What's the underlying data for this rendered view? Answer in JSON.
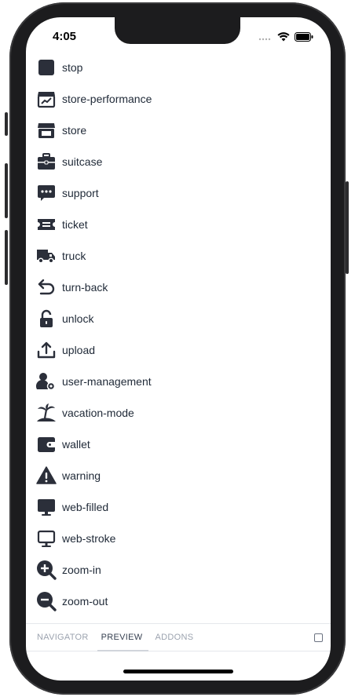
{
  "status_bar": {
    "time": "4:05"
  },
  "icon_list": [
    {
      "label": "stop",
      "icon": "stop-icon"
    },
    {
      "label": "store-performance",
      "icon": "store-performance-icon"
    },
    {
      "label": "store",
      "icon": "store-icon"
    },
    {
      "label": "suitcase",
      "icon": "suitcase-icon"
    },
    {
      "label": "support",
      "icon": "support-icon"
    },
    {
      "label": "ticket",
      "icon": "ticket-icon"
    },
    {
      "label": "truck",
      "icon": "truck-icon"
    },
    {
      "label": "turn-back",
      "icon": "turn-back-icon"
    },
    {
      "label": "unlock",
      "icon": "unlock-icon"
    },
    {
      "label": "upload",
      "icon": "upload-icon"
    },
    {
      "label": "user-management",
      "icon": "user-management-icon"
    },
    {
      "label": "vacation-mode",
      "icon": "vacation-mode-icon"
    },
    {
      "label": "wallet",
      "icon": "wallet-icon"
    },
    {
      "label": "warning",
      "icon": "warning-icon"
    },
    {
      "label": "web-filled",
      "icon": "web-filled-icon"
    },
    {
      "label": "web-stroke",
      "icon": "web-stroke-icon"
    },
    {
      "label": "zoom-in",
      "icon": "zoom-in-icon"
    },
    {
      "label": "zoom-out",
      "icon": "zoom-out-icon"
    }
  ],
  "tabs": [
    {
      "label": "NAVIGATOR",
      "active": false
    },
    {
      "label": "PREVIEW",
      "active": true
    },
    {
      "label": "ADDONS",
      "active": false
    }
  ],
  "colors": {
    "icon": "#2b2f3a",
    "text": "#1f2937",
    "tab_inactive": "#9ca3af",
    "tab_active": "#374151"
  }
}
